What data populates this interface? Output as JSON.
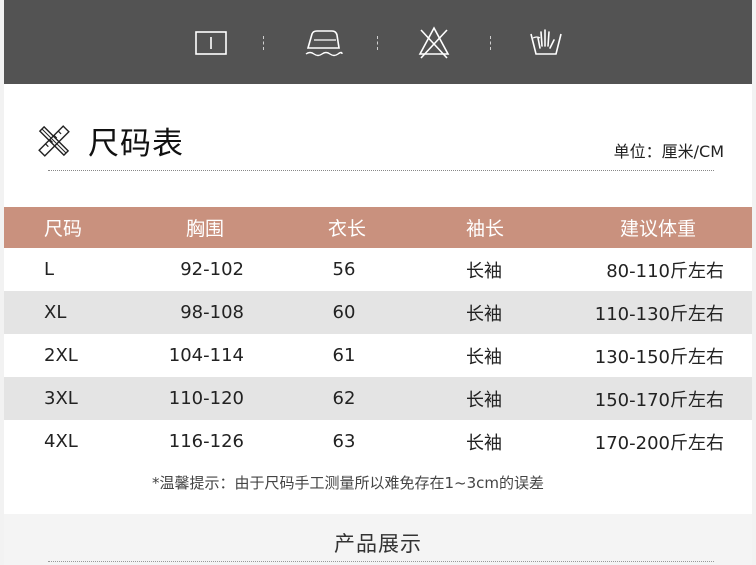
{
  "care_icons": [
    {
      "name": "tumble-dry-icon"
    },
    {
      "name": "iron-icon"
    },
    {
      "name": "do-not-bleach-icon"
    },
    {
      "name": "hand-wash-icon"
    }
  ],
  "title": "尺码表",
  "unit": "单位：厘米/CM",
  "table": {
    "headers": [
      "尺码",
      "胸围",
      "衣长",
      "袖长",
      "建议体重"
    ],
    "rows": [
      [
        "L",
        "92-102",
        "56",
        "长袖",
        "80-110斤左右"
      ],
      [
        "XL",
        "98-108",
        "60",
        "长袖",
        "110-130斤左右"
      ],
      [
        "2XL",
        "104-114",
        "61",
        "长袖",
        "130-150斤左右"
      ],
      [
        "3XL",
        "110-120",
        "62",
        "长袖",
        "150-170斤左右"
      ],
      [
        "4XL",
        "116-126",
        "63",
        "长袖",
        "170-200斤左右"
      ]
    ]
  },
  "note": "*温馨提示：由于尺码手工测量所以难免存在1~3cm的误差",
  "section_title": "产品展示",
  "colors": {
    "care_bar": "#535353",
    "header": "#c9917e",
    "alt_row": "#e4e4e4"
  }
}
